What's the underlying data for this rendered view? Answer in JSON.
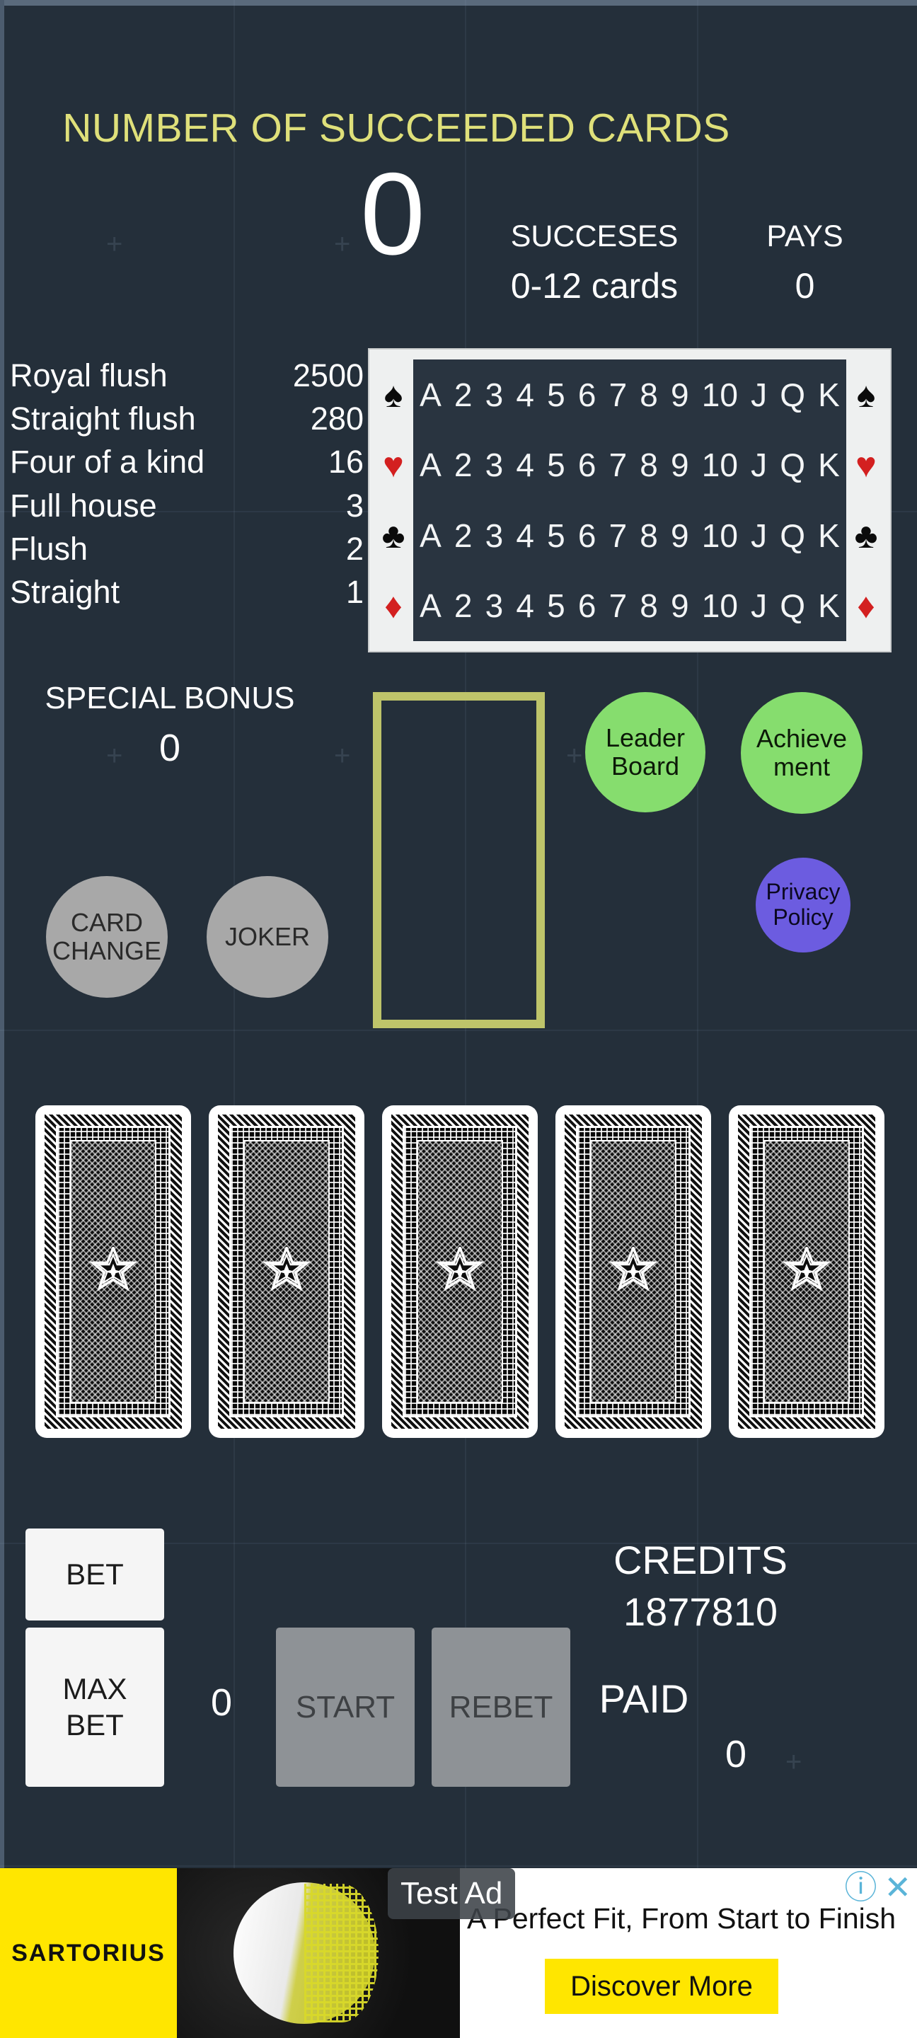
{
  "header": {
    "title": "NUMBER OF SUCCEEDED CARDS",
    "title_color": "#dfe07a",
    "succeeded_count": "0",
    "stats": [
      {
        "label": "SUCCESES",
        "value": "0-12 cards"
      },
      {
        "label": "PAYS",
        "value": "0"
      }
    ]
  },
  "paytable": {
    "rows": [
      {
        "name": "Royal flush",
        "value": "2500"
      },
      {
        "name": "Straight flush",
        "value": "280"
      },
      {
        "name": "Four of a kind",
        "value": "16"
      },
      {
        "name": "Full house",
        "value": "3"
      },
      {
        "name": "Flush",
        "value": "2"
      },
      {
        "name": "Straight",
        "value": "1"
      }
    ]
  },
  "card_grid": {
    "ranks": [
      "A",
      "2",
      "3",
      "4",
      "5",
      "6",
      "7",
      "8",
      "9",
      "10",
      "J",
      "Q",
      "K"
    ],
    "rows": [
      {
        "suit": "spade",
        "symbol": "♠",
        "color": "black"
      },
      {
        "suit": "heart",
        "symbol": "♥",
        "color": "red"
      },
      {
        "suit": "club",
        "symbol": "♣",
        "color": "black"
      },
      {
        "suit": "diamond",
        "symbol": "♦",
        "color": "red"
      }
    ]
  },
  "special_bonus": {
    "label": "SPECIAL BONUS",
    "value": "0"
  },
  "slot": {
    "border_color": "#bec46a"
  },
  "round_buttons": [
    {
      "id": "leader",
      "label": "Leader\nBoard",
      "line1": "Leader",
      "line2": "Board",
      "color": "#86dd6e",
      "enabled": true
    },
    {
      "id": "achievement",
      "label": "Achieve\nment",
      "line1": "Achieve",
      "line2": "ment",
      "color": "#86dd6e",
      "enabled": true
    },
    {
      "id": "privacy",
      "label": "Privacy\nPolicy",
      "line1": "Privacy",
      "line2": "Policy",
      "color": "#6c5ce0",
      "enabled": true
    },
    {
      "id": "card_change",
      "label": "CARD\nCHANGE",
      "line1": "CARD",
      "line2": "CHANGE",
      "color": "#a8a8a8",
      "enabled": false
    },
    {
      "id": "joker",
      "label": "JOKER",
      "line1": "JOKER",
      "line2": "",
      "color": "#a8a8a8",
      "enabled": false
    }
  ],
  "hand": {
    "count": 5,
    "face_down": true
  },
  "controls": {
    "bet_label": "BET",
    "max_bet_line1": "MAX",
    "max_bet_line2": "BET",
    "bet_amount": "0",
    "start_label": "START",
    "rebet_label": "REBET",
    "credits_label": "CREDITS",
    "credits_value": "1877810",
    "paid_label": "PAID",
    "paid_value": "0"
  },
  "ad": {
    "brand": "SARTORIUS",
    "test_label": "Test Ad",
    "headline": "A Perfect Fit, From Start to Finish",
    "cta": "Discover More",
    "info_icon": "ⓘ",
    "close_icon": "✕"
  }
}
